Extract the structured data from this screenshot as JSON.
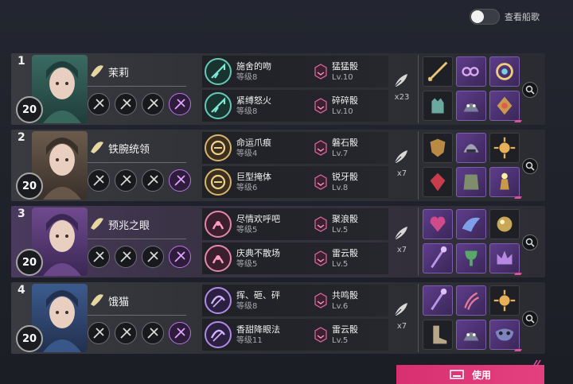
{
  "toggle": {
    "label": "查看船歌",
    "on": false
  },
  "use_button": {
    "label": "使用"
  },
  "colors": {
    "accent": "#e0407f",
    "purple_row": "#4a3a5e",
    "gray_row": "#3a3b40"
  },
  "rows": [
    {
      "index": "1",
      "level": "20",
      "name": "茉莉",
      "name_icon": "leaf-icon",
      "row_style": "gray",
      "talents": [
        "talent-icon",
        "talent-icon",
        "talent-icon",
        "talent-icon"
      ],
      "skills": [
        {
          "name": "施舍的吻",
          "level": "等级8",
          "die_name": "猛猛骰",
          "die_level": "Lv.10",
          "color": "teal"
        },
        {
          "name": "紧缚怒火",
          "level": "等级8",
          "die_name": "碎碎骰",
          "die_level": "Lv.10",
          "color": "teal"
        }
      ],
      "quill_count": "x23",
      "items": [
        "blade",
        "chain",
        "ring",
        "glove",
        "beast",
        "amulet"
      ]
    },
    {
      "index": "2",
      "level": "20",
      "name": "铁腕统领",
      "name_icon": "glove-icon",
      "row_style": "gray",
      "talents": [
        "talent-icon",
        "talent-icon",
        "talent-icon",
        "talent-icon"
      ],
      "skills": [
        {
          "name": "命运爪痕",
          "level": "等级4",
          "die_name": "磐石骰",
          "die_level": "Lv.7",
          "color": "gold"
        },
        {
          "name": "巨型掩体",
          "level": "等级6",
          "die_name": "锐牙骰",
          "die_level": "Lv.8",
          "color": "gold"
        }
      ],
      "quill_count": "x7",
      "items": [
        "shield",
        "helm",
        "sun",
        "gem",
        "armor",
        "lamp"
      ]
    },
    {
      "index": "3",
      "level": "20",
      "name": "预兆之眼",
      "name_icon": "lips-icon",
      "row_style": "purple",
      "talents": [
        "talent-icon",
        "talent-icon",
        "talent-icon",
        "talent-icon"
      ],
      "skills": [
        {
          "name": "尽情欢呼吧",
          "level": "等级5",
          "die_name": "聚浪骰",
          "die_level": "Lv.5",
          "color": "pink"
        },
        {
          "name": "庆典不散场",
          "level": "等级5",
          "die_name": "雷云骰",
          "die_level": "Lv.5",
          "color": "pink"
        }
      ],
      "quill_count": "x7",
      "items": [
        "heart",
        "wing",
        "orb",
        "staff",
        "chalice",
        "crown"
      ]
    },
    {
      "index": "4",
      "level": "20",
      "name": "饿猫",
      "name_icon": "cat-icon",
      "row_style": "gray",
      "talents": [
        "talent-icon",
        "talent-icon",
        "talent-icon",
        "talent-icon"
      ],
      "skills": [
        {
          "name": "挥、砸、砰",
          "level": "等级8",
          "die_name": "共鸣骰",
          "die_level": "Lv.6",
          "color": "violet"
        },
        {
          "name": "香甜降眼法",
          "level": "等级11",
          "die_name": "雷云骰",
          "die_level": "Lv.5",
          "color": "violet"
        }
      ],
      "quill_count": "x7",
      "items": [
        "staff",
        "claw",
        "sun",
        "boot",
        "beast",
        "mask"
      ]
    }
  ]
}
